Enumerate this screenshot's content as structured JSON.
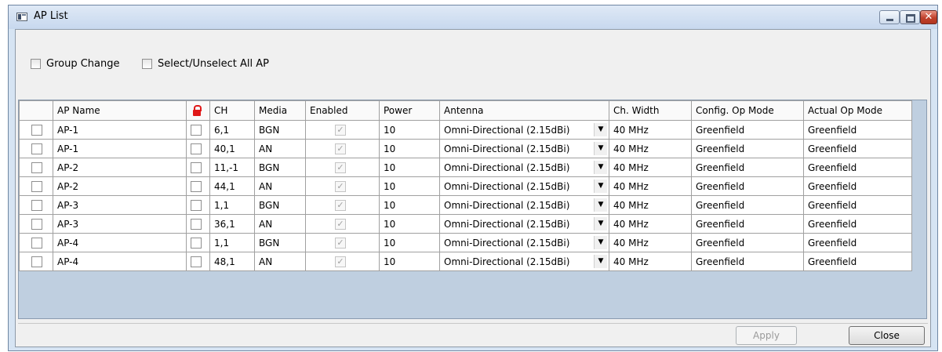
{
  "window": {
    "title": "AP List"
  },
  "options": {
    "group_change": "Group Change",
    "select_all": "Select/Unselect All AP"
  },
  "table": {
    "columns": [
      "",
      "AP Name",
      "",
      "CH",
      "Media",
      "Enabled",
      "Power",
      "Antenna",
      "Ch. Width",
      "Config. Op Mode",
      "Actual Op Mode"
    ],
    "rows": [
      {
        "name": "AP-1",
        "ch": "6,1",
        "media": "BGN",
        "power": "10",
        "antenna": "Omni-Directional (2.15dBi)",
        "width": "40 MHz",
        "config_mode": "Greenfield",
        "actual_mode": "Greenfield"
      },
      {
        "name": "AP-1",
        "ch": "40,1",
        "media": "AN",
        "power": "10",
        "antenna": "Omni-Directional (2.15dBi)",
        "width": "40 MHz",
        "config_mode": "Greenfield",
        "actual_mode": "Greenfield"
      },
      {
        "name": "AP-2",
        "ch": "11,-1",
        "media": "BGN",
        "power": "10",
        "antenna": "Omni-Directional (2.15dBi)",
        "width": "40 MHz",
        "config_mode": "Greenfield",
        "actual_mode": "Greenfield"
      },
      {
        "name": "AP-2",
        "ch": "44,1",
        "media": "AN",
        "power": "10",
        "antenna": "Omni-Directional (2.15dBi)",
        "width": "40 MHz",
        "config_mode": "Greenfield",
        "actual_mode": "Greenfield"
      },
      {
        "name": "AP-3",
        "ch": "1,1",
        "media": "BGN",
        "power": "10",
        "antenna": "Omni-Directional (2.15dBi)",
        "width": "40 MHz",
        "config_mode": "Greenfield",
        "actual_mode": "Greenfield"
      },
      {
        "name": "AP-3",
        "ch": "36,1",
        "media": "AN",
        "power": "10",
        "antenna": "Omni-Directional (2.15dBi)",
        "width": "40 MHz",
        "config_mode": "Greenfield",
        "actual_mode": "Greenfield"
      },
      {
        "name": "AP-4",
        "ch": "1,1",
        "media": "BGN",
        "power": "10",
        "antenna": "Omni-Directional (2.15dBi)",
        "width": "40 MHz",
        "config_mode": "Greenfield",
        "actual_mode": "Greenfield"
      },
      {
        "name": "AP-4",
        "ch": "48,1",
        "media": "AN",
        "power": "10",
        "antenna": "Omni-Directional (2.15dBi)",
        "width": "40 MHz",
        "config_mode": "Greenfield",
        "actual_mode": "Greenfield"
      }
    ]
  },
  "buttons": {
    "apply": "Apply",
    "close": "Close"
  },
  "icons": {
    "app": "app-window-icon",
    "lock": "lock-icon",
    "minimize": "minimize-icon",
    "maximize": "maximize-icon",
    "close": "close-icon",
    "dropdown": "chevron-down-icon"
  },
  "colors": {
    "lock": "#e01818",
    "close_button": "#c0412c",
    "title_bar": "#d6e4f3"
  }
}
